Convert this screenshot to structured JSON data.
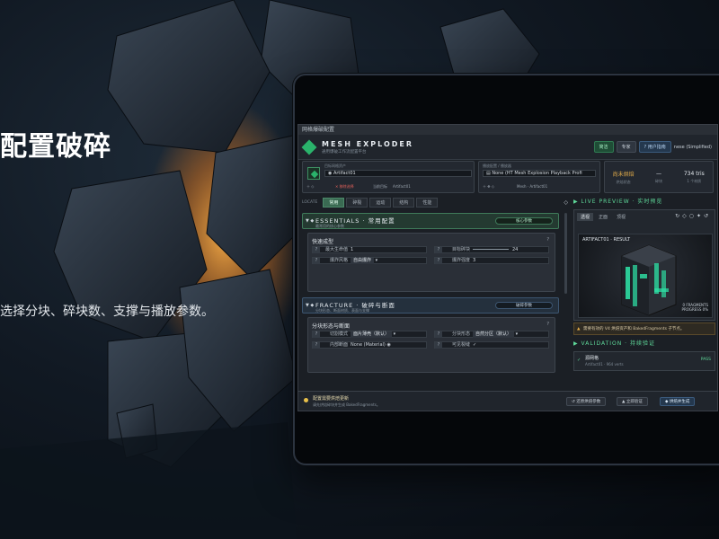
{
  "hero": {
    "headline": "配置破碎",
    "subline": "选择分块、碎块数、支撑与播放参数。"
  },
  "window": {
    "titlebar": "网格爆破配置",
    "app_title": "MESH EXPLODER",
    "app_subtitle": "通用爆破工作流配置平台",
    "header_buttons": [
      "简洁",
      "专家",
      "用户指南"
    ],
    "language": "nese (Simplified)"
  },
  "source_card": {
    "label": "目标网格资产",
    "field_value": "Artifact01",
    "remove_label": "移除选择",
    "target_label": "当前目标",
    "target_value": "Artifact01"
  },
  "preset_card": {
    "label": "播放配置 / 播放器",
    "field_value": "None (HT Mesh Explosion Playback Profi",
    "mesh_label": "Mesh · Artifact01"
  },
  "stats": [
    {
      "value": "尚未烘焙",
      "key": "烘焙状态",
      "warn": true
    },
    {
      "value": "—",
      "key": "碎块",
      "warn": false
    },
    {
      "value": "734 tris",
      "key": "1 个材质",
      "warn": false
    }
  ],
  "left_tabs": {
    "locate": "LOCATE",
    "items": [
      "常用",
      "碎裂",
      "运动",
      "结构",
      "性能"
    ],
    "active": 0
  },
  "essentials": {
    "title": "ESSENTIALS · 常用配置",
    "subtitle": "最常用的核心参数",
    "button": "核心参数",
    "group_title": "快速成型",
    "fields": [
      {
        "key": "最大生命值",
        "value": "1"
      },
      {
        "key": "目标碎块",
        "value": "24"
      },
      {
        "key": "爆炸风格",
        "value": "自由爆炸"
      },
      {
        "key": "爆炸强度",
        "value": "3"
      }
    ]
  },
  "fracture": {
    "title": "FRACTURE · 破碎与断面",
    "subtitle": "分块形态、断面材质、表面与支撑",
    "button": "破碎参数",
    "group_title": "分块形态与断面",
    "fields": [
      {
        "key": "切割模式",
        "value": "面片薄壳（默认）"
      },
      {
        "key": "分块形态",
        "value": "自然分区（默认）"
      },
      {
        "key": "内部断面",
        "value": "None (Material)"
      },
      {
        "key": "可见裂缝",
        "value": "✓"
      }
    ]
  },
  "preview": {
    "title": "LIVE PREVIEW · 实时预览",
    "tabs": [
      "透视",
      "正面",
      "顶视"
    ],
    "active_tab": 0,
    "result_label": "ARTIFACT01 · RESULT",
    "fragments": "0 FRAGMENTS",
    "progress": "PROGRESS 0%",
    "warning": "需要有效的 V4 烘焙资产和 BakedFragments 子节点。"
  },
  "validation": {
    "title": "VALIDATION · 持续验证",
    "item_name": "源网格",
    "item_desc": "Artifact01 · 964 verts",
    "item_status": "PASS"
  },
  "footer": {
    "title": "配置需要烘焙更新",
    "subtitle": "请先烘焙碎块并生成 BakedFragments。",
    "buttons": [
      "还原烘焙参数",
      "立即验证",
      "烘焙并生成"
    ]
  },
  "colors": {
    "accent_green": "#2ab36b",
    "warn_amber": "#e8b04a",
    "glow_orange": "#f29a2e"
  }
}
